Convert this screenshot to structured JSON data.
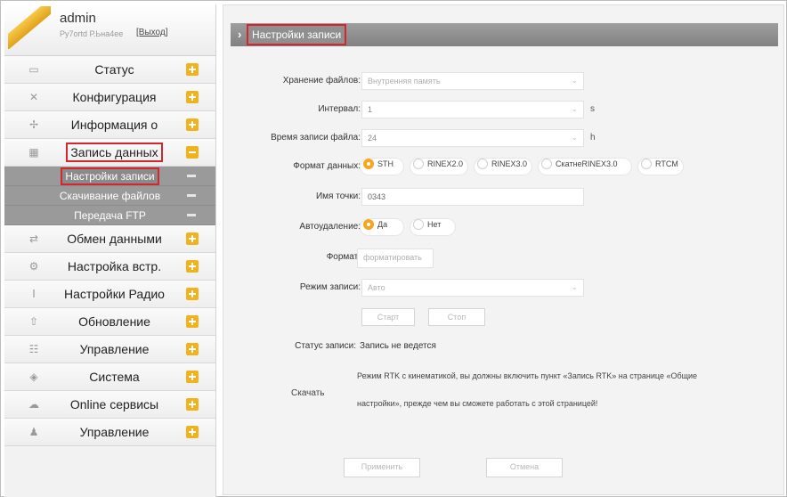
{
  "user": {
    "name": "admin",
    "subtitle": "Ру7оrtd Р.Ьна4ее",
    "logout": "[Выход]"
  },
  "sidebar": {
    "items": [
      {
        "label": "Статус",
        "icon": "monitor-icon"
      },
      {
        "label": "Конфигурация",
        "icon": "tools-icon"
      },
      {
        "label": "Информация о",
        "icon": "satellite-icon"
      },
      {
        "label": "Запись данных",
        "icon": "calendar-icon"
      },
      {
        "label": "Обмен данными",
        "icon": "exchange-icon"
      },
      {
        "label": "Настройка встр.",
        "icon": "gear-icon"
      },
      {
        "label": "Настройки Радио",
        "icon": "antenna-icon"
      },
      {
        "label": "Обновление",
        "icon": "upload-icon"
      },
      {
        "label": "Управление",
        "icon": "sliders-icon"
      },
      {
        "label": "Система",
        "icon": "system-icon"
      },
      {
        "label": "Online сервисы",
        "icon": "cloud-icon"
      },
      {
        "label": "Управление",
        "icon": "person-icon"
      }
    ],
    "submenu": [
      {
        "label": "Настройки записи"
      },
      {
        "label": "Скачивание файлов"
      },
      {
        "label": "Передача FTP"
      }
    ]
  },
  "page": {
    "title": "Настройки записи"
  },
  "form": {
    "storage": {
      "label": "Хранение файлов:",
      "value": "Внутренняя память"
    },
    "interval": {
      "label": "Интервал:",
      "value": "1",
      "unit": "s"
    },
    "duration": {
      "label": "Время записи файла:",
      "value": "24",
      "unit": "h"
    },
    "format": {
      "label": "Формат данных:",
      "options": [
        "STH",
        "RINEX2.0",
        "RINEX3.0",
        "CкатнеRINEX3.0",
        "RTCM"
      ],
      "selected": "STH"
    },
    "point": {
      "label": "Имя точки:",
      "value": "0343"
    },
    "autodelete": {
      "label": "Автоудаление:",
      "options": [
        "Да",
        "Нет"
      ],
      "selected": "Да"
    },
    "fmt": {
      "label": "Формат:",
      "placeholder": "форматировать"
    },
    "mode": {
      "label": "Режим записи:",
      "value": "Авто"
    },
    "start_button": "Старт",
    "stop_button": "Стоп",
    "status": {
      "label": "Статус записи:",
      "value": "Запись не ведется"
    },
    "download": {
      "label": "Скачать",
      "line1": "Режим RTK с кинематикой, вы должны включить пункт «Запись RTK» на странице «Общие",
      "line2": "настройки», прежде чем вы сможете работать с этой страницей!"
    },
    "apply_button": "Применить",
    "cancel_button": "Отмена"
  },
  "colors": {
    "accent": "#f7a51f",
    "highlight_border": "#d6262d",
    "submenu_bg": "#9a9a9a"
  }
}
